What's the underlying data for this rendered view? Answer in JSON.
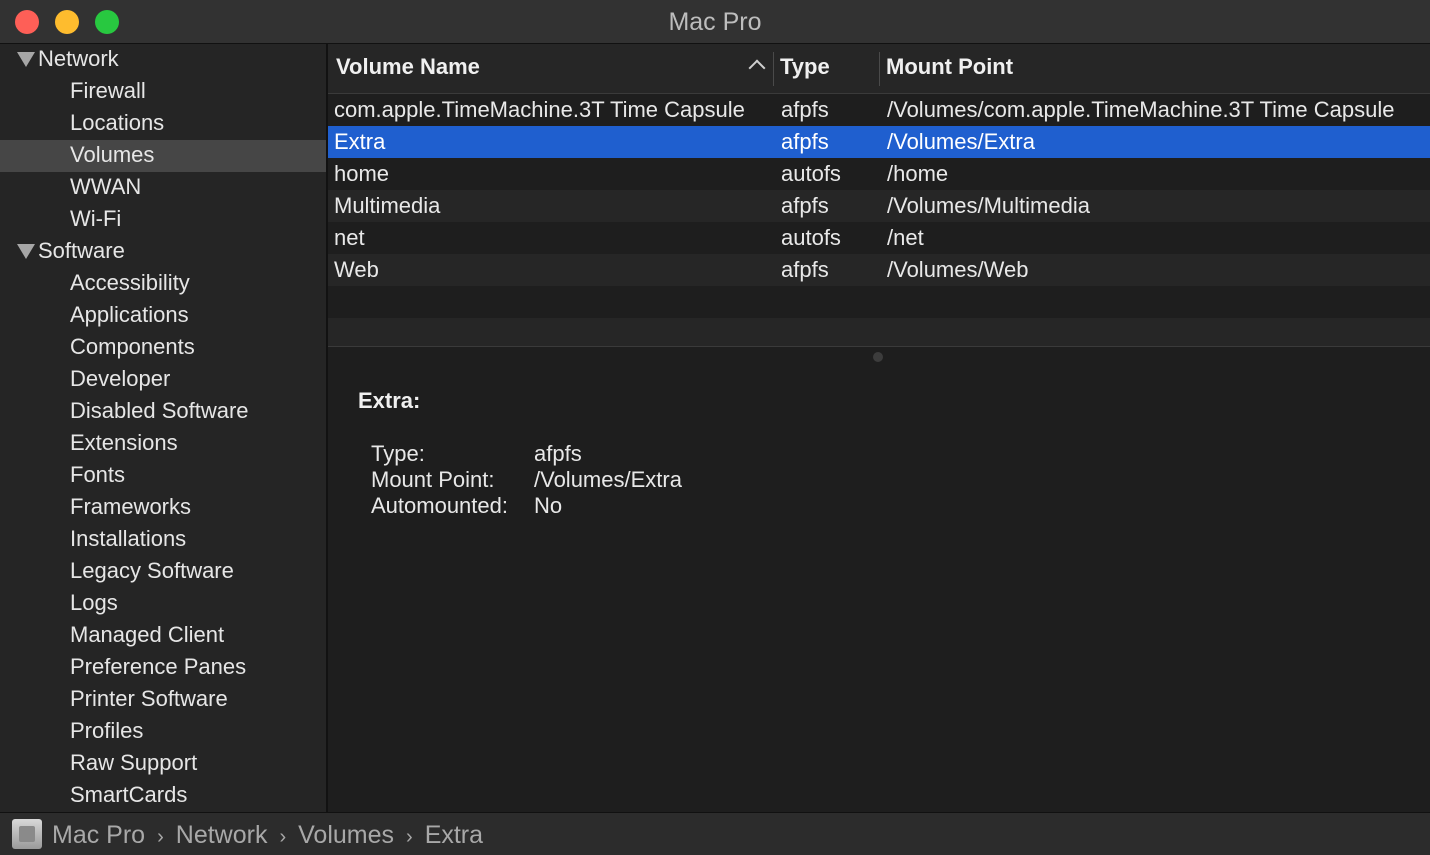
{
  "window": {
    "title": "Mac Pro"
  },
  "sidebar": {
    "groups": [
      {
        "label": "Network",
        "items": [
          "Firewall",
          "Locations",
          "Volumes",
          "WWAN",
          "Wi-Fi"
        ]
      },
      {
        "label": "Software",
        "items": [
          "Accessibility",
          "Applications",
          "Components",
          "Developer",
          "Disabled Software",
          "Extensions",
          "Fonts",
          "Frameworks",
          "Installations",
          "Legacy Software",
          "Logs",
          "Managed Client",
          "Preference Panes",
          "Printer Software",
          "Profiles",
          "Raw Support",
          "SmartCards"
        ]
      }
    ],
    "selected": "Volumes"
  },
  "table": {
    "columns": [
      "Volume Name",
      "Type",
      "Mount Point"
    ],
    "rows": [
      {
        "name": "com.apple.TimeMachine.3T Time Capsule",
        "type": "afpfs",
        "mount": "/Volumes/com.apple.TimeMachine.3T Time Capsule"
      },
      {
        "name": "Extra",
        "type": "afpfs",
        "mount": "/Volumes/Extra"
      },
      {
        "name": "home",
        "type": "autofs",
        "mount": "/home"
      },
      {
        "name": "Multimedia",
        "type": "afpfs",
        "mount": "/Volumes/Multimedia"
      },
      {
        "name": "net",
        "type": "autofs",
        "mount": "/net"
      },
      {
        "name": "Web",
        "type": "afpfs",
        "mount": "/Volumes/Web"
      }
    ],
    "selected_row": "Extra"
  },
  "detail": {
    "title": "Extra:",
    "fields": [
      {
        "label": "Type:",
        "value": "afpfs"
      },
      {
        "label": "Mount Point:",
        "value": "/Volumes/Extra"
      },
      {
        "label": "Automounted:",
        "value": "No"
      }
    ]
  },
  "pathbar": {
    "crumbs": [
      "Mac Pro",
      "Network",
      "Volumes",
      "Extra"
    ],
    "separator": "›",
    "icon": "mac-pro-icon"
  },
  "colors": {
    "selection": "#1f5fcf",
    "close": "#fe5f57",
    "minimize": "#febc2e",
    "zoom": "#28c840"
  }
}
